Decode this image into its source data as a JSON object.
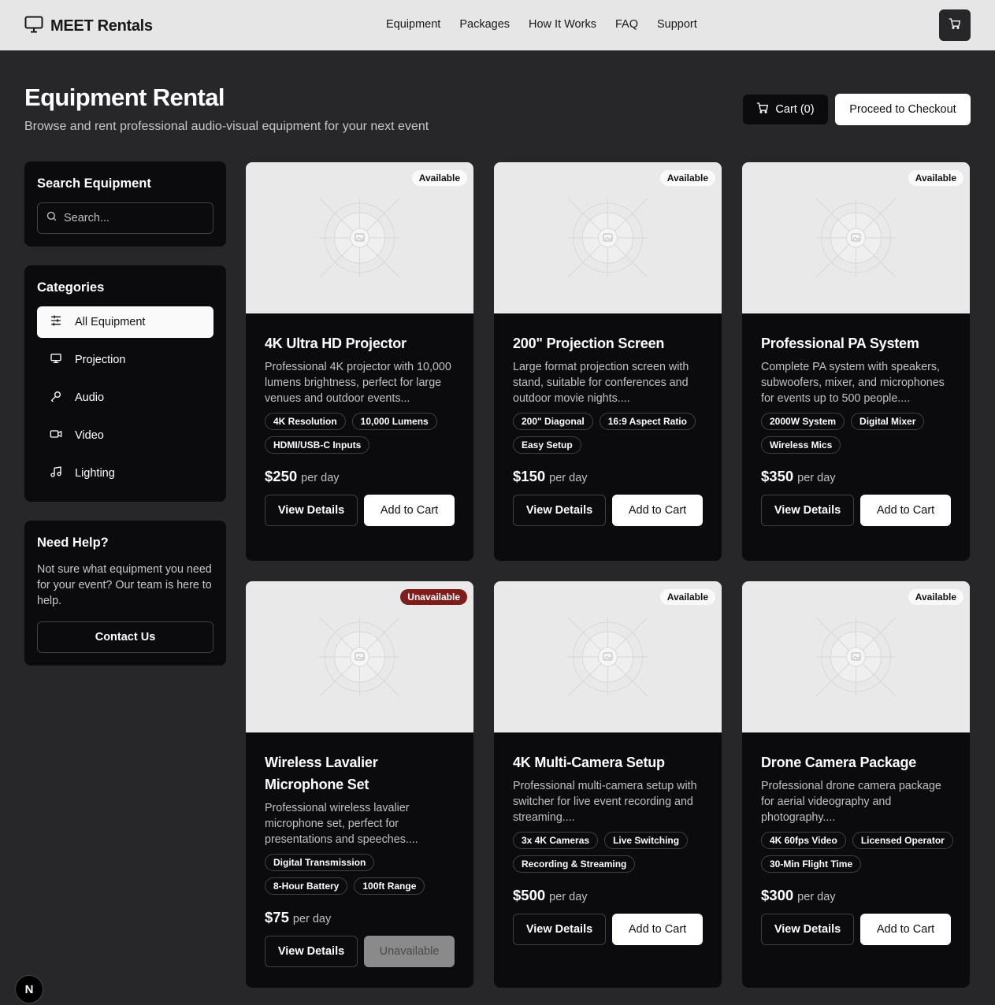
{
  "header": {
    "brand": "MEET Rentals",
    "nav": [
      "Equipment",
      "Packages",
      "How It Works",
      "FAQ",
      "Support"
    ]
  },
  "page": {
    "title": "Equipment Rental",
    "subtitle": "Browse and rent professional audio-visual equipment for your next event",
    "cart_label": "Cart (0)",
    "checkout_label": "Proceed to Checkout"
  },
  "sidebar": {
    "search": {
      "title": "Search Equipment",
      "placeholder": "Search..."
    },
    "categories": {
      "title": "Categories",
      "items": [
        {
          "label": "All Equipment",
          "icon": "sliders-icon"
        },
        {
          "label": "Projection",
          "icon": "monitor-icon"
        },
        {
          "label": "Audio",
          "icon": "microphone-icon"
        },
        {
          "label": "Video",
          "icon": "video-camera-icon"
        },
        {
          "label": "Lighting",
          "icon": "music-note-icon"
        }
      ]
    },
    "help": {
      "title": "Need Help?",
      "text": "Not sure what equipment you need for your event? Our team is here to help.",
      "button": "Contact Us"
    }
  },
  "products": [
    {
      "status": "Available",
      "name": "4K Ultra HD Projector",
      "description": "Professional 4K projector with 10,000 lumens brightness, perfect for large venues and outdoor events...",
      "features": [
        "4K Resolution",
        "10,000 Lumens",
        "HDMI/USB-C Inputs"
      ],
      "price": "$250",
      "per": "per day",
      "details_label": "View Details",
      "action_label": "Add to Cart"
    },
    {
      "status": "Available",
      "name": "200\" Projection Screen",
      "description": "Large format projection screen with stand, suitable for conferences and outdoor movie nights....",
      "features": [
        "200\" Diagonal",
        "16:9 Aspect Ratio",
        "Easy Setup"
      ],
      "price": "$150",
      "per": "per day",
      "details_label": "View Details",
      "action_label": "Add to Cart"
    },
    {
      "status": "Available",
      "name": "Professional PA System",
      "description": "Complete PA system with speakers, subwoofers, mixer, and microphones for events up to 500 people....",
      "features": [
        "2000W System",
        "Digital Mixer",
        "Wireless Mics"
      ],
      "price": "$350",
      "per": "per day",
      "details_label": "View Details",
      "action_label": "Add to Cart"
    },
    {
      "status": "Unavailable",
      "name": "Wireless Lavalier Microphone Set",
      "description": "Professional wireless lavalier microphone set, perfect for presentations and speeches....",
      "features": [
        "Digital Transmission",
        "8-Hour Battery",
        "100ft Range"
      ],
      "price": "$75",
      "per": "per day",
      "details_label": "View Details",
      "action_label": "Unavailable"
    },
    {
      "status": "Available",
      "name": "4K Multi-Camera Setup",
      "description": "Professional multi-camera setup with switcher for live event recording and streaming....",
      "features": [
        "3x 4K Cameras",
        "Live Switching",
        "Recording & Streaming"
      ],
      "price": "$500",
      "per": "per day",
      "details_label": "View Details",
      "action_label": "Add to Cart"
    },
    {
      "status": "Available",
      "name": "Drone Camera Package",
      "description": "Professional drone camera package for aerial videography and photography....",
      "features": [
        "4K 60fps Video",
        "Licensed Operator",
        "30-Min Flight Time"
      ],
      "price": "$300",
      "per": "per day",
      "details_label": "View Details",
      "action_label": "Add to Cart"
    }
  ],
  "dev_badge": "N"
}
